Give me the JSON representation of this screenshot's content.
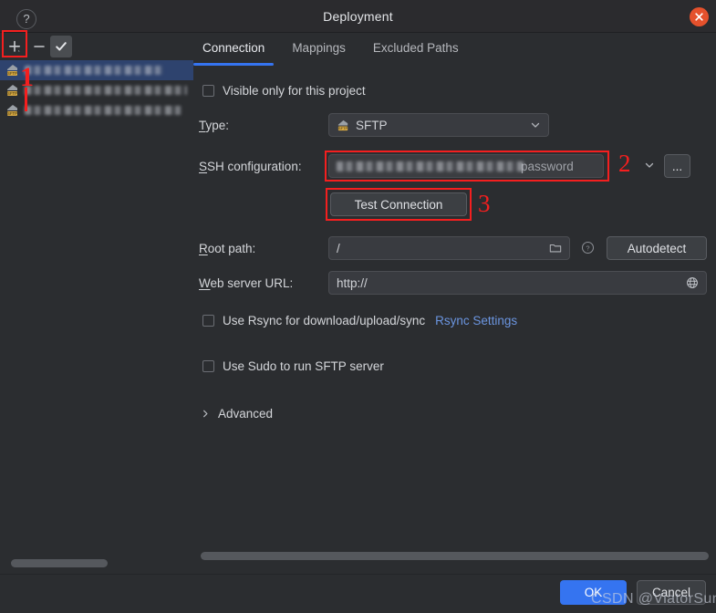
{
  "window": {
    "title": "Deployment",
    "close_icon": "close-circle-icon"
  },
  "left_panel": {
    "toolbar": {
      "add_label": "+",
      "remove_label": "−",
      "set_default_label": "✓",
      "add_icon": "plus-icon",
      "remove_icon": "minus-icon",
      "default_icon": "check-icon"
    },
    "servers": [
      {
        "name": "",
        "redacted": true,
        "selected": true,
        "icon": "sftp-server-icon"
      },
      {
        "name": "",
        "redacted": true,
        "selected": false,
        "icon": "sftp-server-icon"
      },
      {
        "name": "",
        "redacted": true,
        "selected": false,
        "icon": "sftp-server-icon"
      }
    ]
  },
  "tabs": [
    {
      "label": "Connection",
      "active": true
    },
    {
      "label": "Mappings",
      "active": false
    },
    {
      "label": "Excluded Paths",
      "active": false
    }
  ],
  "form": {
    "visible_only_label": "Visible only for this project",
    "visible_only_checked": false,
    "type_label": "Type:",
    "type_value": "SFTP",
    "type_icon": "sftp-server-icon",
    "ssh_config_label": "SSH configuration:",
    "ssh_config_value": "",
    "ssh_config_suffix": "password",
    "ssh_config_browse_label": "...",
    "test_connection_label": "Test Connection",
    "root_path_label": "Root path:",
    "root_path_value": "/",
    "root_path_folder_icon": "folder-icon",
    "root_path_help_icon": "question-circle-icon",
    "autodetect_label": "Autodetect",
    "web_server_url_label": "Web server URL:",
    "web_server_url_value": "http://",
    "web_server_globe_icon": "globe-icon",
    "use_rsync_label": "Use Rsync for download/upload/sync",
    "use_rsync_checked": false,
    "rsync_settings_link": "Rsync Settings",
    "use_sudo_label": "Use Sudo to run SFTP server",
    "use_sudo_checked": false,
    "advanced_label": "Advanced",
    "advanced_icon": "chevron-right-icon"
  },
  "annotations": [
    {
      "id": "1",
      "text": "1"
    },
    {
      "id": "2",
      "text": "2"
    },
    {
      "id": "3",
      "text": "3"
    }
  ],
  "footer": {
    "help_label": "?",
    "ok_label": "OK",
    "cancel_label": "Cancel"
  },
  "watermark": "CSDN @ViatorSun",
  "colors": {
    "accent": "#3574f0",
    "annotation_red": "#f41f1f",
    "close_red": "#e5512c",
    "link_blue": "#6b95e0",
    "dialog_bg": "#2b2d30",
    "field_bg": "#393b40",
    "selection_blue": "#2e436e"
  }
}
